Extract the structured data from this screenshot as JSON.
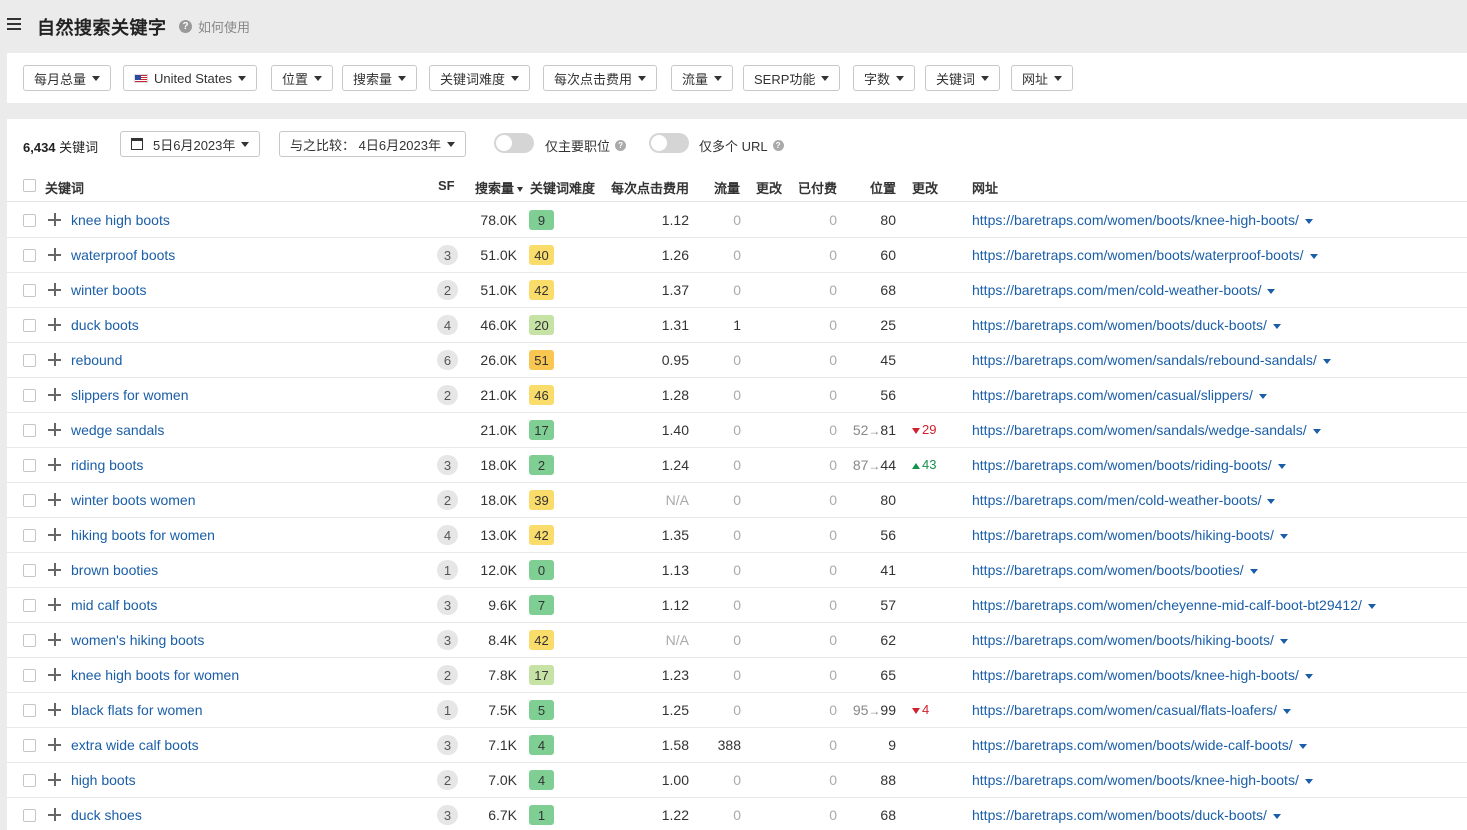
{
  "header": {
    "title": "自然搜索关键字",
    "help_label": "如何使用"
  },
  "filters": [
    {
      "label": "每月总量"
    },
    {
      "label": "United States",
      "flag": true
    },
    {
      "label": "位置"
    },
    {
      "label": "搜索量"
    },
    {
      "label": "关键词难度"
    },
    {
      "label": "每次点击费用"
    },
    {
      "label": "流量"
    },
    {
      "label": "SERP功能"
    },
    {
      "label": "字数"
    },
    {
      "label": "关键词"
    },
    {
      "label": "网址"
    }
  ],
  "toolbar": {
    "count_number": "6,434",
    "count_label": "关键词",
    "date_label": "5日6月2023年",
    "compare_label": "与之比较： 4日6月2023年",
    "toggle1_label": "仅主要职位",
    "toggle2_label": "仅多个 URL"
  },
  "columns": {
    "keyword": "关键词",
    "sf": "SF",
    "volume": "搜索量",
    "kd": "关键词难度",
    "cpc": "每次点击费用",
    "traffic": "流量",
    "traffic_change": "更改",
    "paid": "已付费",
    "position": "位置",
    "position_change": "更改",
    "url": "网址"
  },
  "kd_colors": {
    "green_dark": "#7fcf94",
    "green_light": "#c6e3a5",
    "yellow": "#fadc6b",
    "orange": "#f8c651"
  },
  "rows": [
    {
      "keyword": "knee high boots",
      "sf": "",
      "volume": "78.0K",
      "kd": "9",
      "kd_color": "#7fcf94",
      "cpc": "1.12",
      "traffic": "0",
      "paid": "0",
      "pos_prev": "",
      "position": "80",
      "pos_change": "",
      "pos_dir": "",
      "url": "https://baretraps.com/women/boots/knee-high-boots/"
    },
    {
      "keyword": "waterproof boots",
      "sf": "3",
      "volume": "51.0K",
      "kd": "40",
      "kd_color": "#fadc6b",
      "cpc": "1.26",
      "traffic": "0",
      "paid": "0",
      "pos_prev": "",
      "position": "60",
      "pos_change": "",
      "pos_dir": "",
      "url": "https://baretraps.com/women/boots/waterproof-boots/"
    },
    {
      "keyword": "winter boots",
      "sf": "2",
      "volume": "51.0K",
      "kd": "42",
      "kd_color": "#fadc6b",
      "cpc": "1.37",
      "traffic": "0",
      "paid": "0",
      "pos_prev": "",
      "position": "68",
      "pos_change": "",
      "pos_dir": "",
      "url": "https://baretraps.com/men/cold-weather-boots/"
    },
    {
      "keyword": "duck boots",
      "sf": "4",
      "volume": "46.0K",
      "kd": "20",
      "kd_color": "#c6e3a5",
      "cpc": "1.31",
      "traffic": "1",
      "paid": "0",
      "pos_prev": "",
      "position": "25",
      "pos_change": "",
      "pos_dir": "",
      "url": "https://baretraps.com/women/boots/duck-boots/"
    },
    {
      "keyword": "rebound",
      "sf": "6",
      "volume": "26.0K",
      "kd": "51",
      "kd_color": "#f8c651",
      "cpc": "0.95",
      "traffic": "0",
      "paid": "0",
      "pos_prev": "",
      "position": "45",
      "pos_change": "",
      "pos_dir": "",
      "url": "https://baretraps.com/women/sandals/rebound-sandals/"
    },
    {
      "keyword": "slippers for women",
      "sf": "2",
      "volume": "21.0K",
      "kd": "46",
      "kd_color": "#fadc6b",
      "cpc": "1.28",
      "traffic": "0",
      "paid": "0",
      "pos_prev": "",
      "position": "56",
      "pos_change": "",
      "pos_dir": "",
      "url": "https://baretraps.com/women/casual/slippers/"
    },
    {
      "keyword": "wedge sandals",
      "sf": "",
      "volume": "21.0K",
      "kd": "17",
      "kd_color": "#7fcf94",
      "cpc": "1.40",
      "traffic": "0",
      "paid": "0",
      "pos_prev": "52",
      "position": "81",
      "pos_change": "29",
      "pos_dir": "down",
      "url": "https://baretraps.com/women/sandals/wedge-sandals/"
    },
    {
      "keyword": "riding boots",
      "sf": "3",
      "volume": "18.0K",
      "kd": "2",
      "kd_color": "#7fcf94",
      "cpc": "1.24",
      "traffic": "0",
      "paid": "0",
      "pos_prev": "87",
      "position": "44",
      "pos_change": "43",
      "pos_dir": "up",
      "url": "https://baretraps.com/women/boots/riding-boots/"
    },
    {
      "keyword": "winter boots women",
      "sf": "2",
      "volume": "18.0K",
      "kd": "39",
      "kd_color": "#fadc6b",
      "cpc": "N/A",
      "traffic": "0",
      "paid": "0",
      "pos_prev": "",
      "position": "80",
      "pos_change": "",
      "pos_dir": "",
      "url": "https://baretraps.com/men/cold-weather-boots/"
    },
    {
      "keyword": "hiking boots for women",
      "sf": "4",
      "volume": "13.0K",
      "kd": "42",
      "kd_color": "#fadc6b",
      "cpc": "1.35",
      "traffic": "0",
      "paid": "0",
      "pos_prev": "",
      "position": "56",
      "pos_change": "",
      "pos_dir": "",
      "url": "https://baretraps.com/women/boots/hiking-boots/"
    },
    {
      "keyword": "brown booties",
      "sf": "1",
      "volume": "12.0K",
      "kd": "0",
      "kd_color": "#7fcf94",
      "cpc": "1.13",
      "traffic": "0",
      "paid": "0",
      "pos_prev": "",
      "position": "41",
      "pos_change": "",
      "pos_dir": "",
      "url": "https://baretraps.com/women/boots/booties/"
    },
    {
      "keyword": "mid calf boots",
      "sf": "3",
      "volume": "9.6K",
      "kd": "7",
      "kd_color": "#7fcf94",
      "cpc": "1.12",
      "traffic": "0",
      "paid": "0",
      "pos_prev": "",
      "position": "57",
      "pos_change": "",
      "pos_dir": "",
      "url": "https://baretraps.com/women/cheyenne-mid-calf-boot-bt29412/"
    },
    {
      "keyword": "women's hiking boots",
      "sf": "3",
      "volume": "8.4K",
      "kd": "42",
      "kd_color": "#fadc6b",
      "cpc": "N/A",
      "traffic": "0",
      "paid": "0",
      "pos_prev": "",
      "position": "62",
      "pos_change": "",
      "pos_dir": "",
      "url": "https://baretraps.com/women/boots/hiking-boots/"
    },
    {
      "keyword": "knee high boots for women",
      "sf": "2",
      "volume": "7.8K",
      "kd": "17",
      "kd_color": "#c6e3a5",
      "cpc": "1.23",
      "traffic": "0",
      "paid": "0",
      "pos_prev": "",
      "position": "65",
      "pos_change": "",
      "pos_dir": "",
      "url": "https://baretraps.com/women/boots/knee-high-boots/"
    },
    {
      "keyword": "black flats for women",
      "sf": "1",
      "volume": "7.5K",
      "kd": "5",
      "kd_color": "#7fcf94",
      "cpc": "1.25",
      "traffic": "0",
      "paid": "0",
      "pos_prev": "95",
      "position": "99",
      "pos_change": "4",
      "pos_dir": "down",
      "url": "https://baretraps.com/women/casual/flats-loafers/"
    },
    {
      "keyword": "extra wide calf boots",
      "sf": "3",
      "volume": "7.1K",
      "kd": "4",
      "kd_color": "#7fcf94",
      "cpc": "1.58",
      "traffic": "388",
      "paid": "0",
      "pos_prev": "",
      "position": "9",
      "pos_change": "",
      "pos_dir": "",
      "url": "https://baretraps.com/women/boots/wide-calf-boots/"
    },
    {
      "keyword": "high boots",
      "sf": "2",
      "volume": "7.0K",
      "kd": "4",
      "kd_color": "#7fcf94",
      "cpc": "1.00",
      "traffic": "0",
      "paid": "0",
      "pos_prev": "",
      "position": "88",
      "pos_change": "",
      "pos_dir": "",
      "url": "https://baretraps.com/women/boots/knee-high-boots/"
    },
    {
      "keyword": "duck shoes",
      "sf": "3",
      "volume": "6.7K",
      "kd": "1",
      "kd_color": "#7fcf94",
      "cpc": "1.22",
      "traffic": "0",
      "paid": "0",
      "pos_prev": "",
      "position": "68",
      "pos_change": "",
      "pos_dir": "",
      "url": "https://baretraps.com/women/boots/duck-boots/"
    }
  ]
}
